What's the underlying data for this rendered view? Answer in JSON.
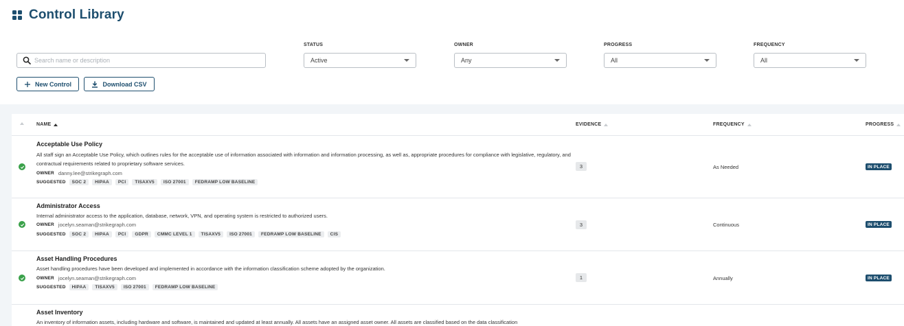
{
  "header": {
    "title": "Control Library"
  },
  "search": {
    "placeholder": "Search name or description",
    "value": ""
  },
  "filters": [
    {
      "label": "STATUS",
      "value": "Active"
    },
    {
      "label": "OWNER",
      "value": "Any"
    },
    {
      "label": "PROGRESS",
      "value": "All"
    },
    {
      "label": "FREQUENCY",
      "value": "All"
    }
  ],
  "actions": {
    "new_control": "New Control",
    "download_csv": "Download CSV"
  },
  "table": {
    "columns": {
      "name": "NAME",
      "evidence": "EVIDENCE",
      "frequency": "FREQUENCY",
      "progress": "PROGRESS"
    },
    "owner_label": "OWNER",
    "suggested_label": "SUGGESTED",
    "rows": [
      {
        "name": "Acceptable Use Policy",
        "description": "All staff sign an Acceptable Use Policy, which outlines rules for the acceptable use of information associated with information and information processing, as well as, appropriate procedures for compliance with legislative, regulatory, and contractual requirements related to proprietary software services.",
        "owner": "danny.lee@strikegraph.com",
        "tags": [
          "SOC 2",
          "HIPAA",
          "PCI",
          "TISAXV5",
          "ISO 27001",
          "FEDRAMP LOW BASELINE"
        ],
        "evidence": "3",
        "frequency": "As Needed",
        "progress": "IN PLACE"
      },
      {
        "name": "Administrator Access",
        "description": "Internal administrator access to the application, database, network, VPN, and operating system is restricted to authorized users.",
        "owner": "jocelyn.seaman@strikegraph.com",
        "tags": [
          "SOC 2",
          "HIPAA",
          "PCI",
          "GDPR",
          "CMMC LEVEL 1",
          "TISAXV5",
          "ISO 27001",
          "FEDRAMP LOW BASELINE",
          "CIS"
        ],
        "evidence": "3",
        "frequency": "Continuous",
        "progress": "IN PLACE"
      },
      {
        "name": "Asset Handling Procedures",
        "description": "Asset handling procedures have been developed and implemented in accordance with the information classification scheme adopted by the organization.",
        "owner": "jocelyn.seaman@strikegraph.com",
        "tags": [
          "HIPAA",
          "TISAXV5",
          "ISO 27001",
          "FEDRAMP LOW BASELINE"
        ],
        "evidence": "1",
        "frequency": "Annually",
        "progress": "IN PLACE"
      },
      {
        "name": "Asset Inventory",
        "description": "An inventory of information assets, including hardware and software, is maintained and updated at least annually. All assets have an assigned asset owner. All assets are classified based on the data classification"
      }
    ]
  }
}
